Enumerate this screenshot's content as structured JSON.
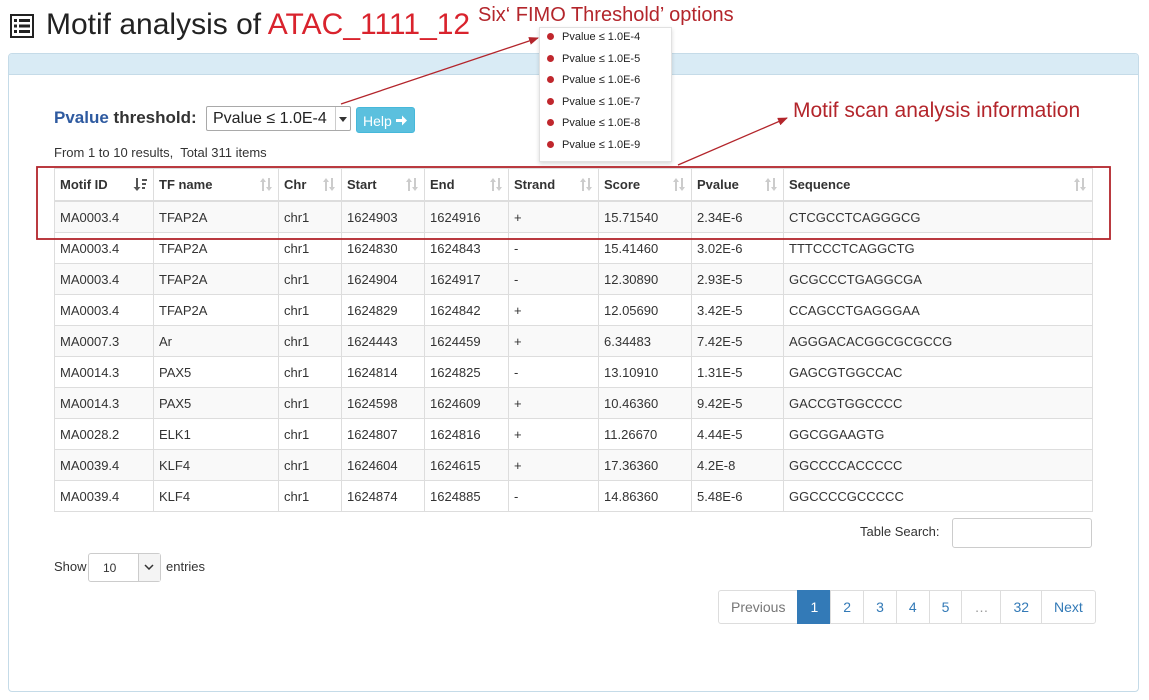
{
  "page": {
    "title_prefix": "Motif analysis of ",
    "title_highlight": "ATAC_1111_12"
  },
  "threshold": {
    "label_blue": "Pvalue",
    "label_rest": " threshold:",
    "selected": "Pvalue ≤ 1.0E-4",
    "help_label": "Help",
    "options": [
      "Pvalue ≤ 1.0E-4",
      "Pvalue ≤ 1.0E-5",
      "Pvalue ≤ 1.0E-6",
      "Pvalue ≤ 1.0E-7",
      "Pvalue ≤ 1.0E-8",
      "Pvalue ≤ 1.0E-9"
    ]
  },
  "results_text": "From 1 to 10 results,  Total 311 items",
  "callouts": {
    "fimo": "Six‘ FIMO Threshold’ options",
    "scan": "Motif  scan analysis information"
  },
  "table": {
    "columns": [
      "Motif ID",
      "TF name",
      "Chr",
      "Start",
      "End",
      "Strand",
      "Score",
      "Pvalue",
      "Sequence"
    ],
    "rows": [
      [
        "MA0003.4",
        "TFAP2A",
        "chr1",
        "1624903",
        "1624916",
        "+",
        "15.71540",
        "2.34E-6",
        "CTCGCCTCAGGGCG"
      ],
      [
        "MA0003.4",
        "TFAP2A",
        "chr1",
        "1624830",
        "1624843",
        "-",
        "15.41460",
        "3.02E-6",
        "TTTCCCTCAGGCTG"
      ],
      [
        "MA0003.4",
        "TFAP2A",
        "chr1",
        "1624904",
        "1624917",
        "-",
        "12.30890",
        "2.93E-5",
        "GCGCCCTGAGGCGA"
      ],
      [
        "MA0003.4",
        "TFAP2A",
        "chr1",
        "1624829",
        "1624842",
        "+",
        "12.05690",
        "3.42E-5",
        "CCAGCCTGAGGGAA"
      ],
      [
        "MA0007.3",
        "Ar",
        "chr1",
        "1624443",
        "1624459",
        "+",
        "6.34483",
        "7.42E-5",
        "AGGGACACGGCGCGCCG"
      ],
      [
        "MA0014.3",
        "PAX5",
        "chr1",
        "1624814",
        "1624825",
        "-",
        "13.10910",
        "1.31E-5",
        "GAGCGTGGCCAC"
      ],
      [
        "MA0014.3",
        "PAX5",
        "chr1",
        "1624598",
        "1624609",
        "+",
        "10.46360",
        "9.42E-5",
        "GACCGTGGCCCC"
      ],
      [
        "MA0028.2",
        "ELK1",
        "chr1",
        "1624807",
        "1624816",
        "+",
        "11.26670",
        "4.44E-5",
        "GGCGGAAGTG"
      ],
      [
        "MA0039.4",
        "KLF4",
        "chr1",
        "1624604",
        "1624615",
        "+",
        "17.36360",
        "4.2E-8",
        "GGCCCCACCCCC"
      ],
      [
        "MA0039.4",
        "KLF4",
        "chr1",
        "1624874",
        "1624885",
        "-",
        "14.86360",
        "5.48E-6",
        "GGCCCCGCCCCC"
      ]
    ]
  },
  "search": {
    "label": "Table Search:",
    "value": ""
  },
  "length": {
    "show_label": "Show",
    "value": "10",
    "entries_label": "entries"
  },
  "pagination": {
    "previous": "Previous",
    "pages": [
      "1",
      "2",
      "3",
      "4",
      "5",
      "…",
      "32"
    ],
    "active": "1",
    "next": "Next"
  },
  "colors": {
    "accent": "#b3252b",
    "title_highlight": "#d9232d",
    "help_button": "#5bc0de",
    "active_page": "#337ab7",
    "panel_header": "#d9ebf5"
  }
}
